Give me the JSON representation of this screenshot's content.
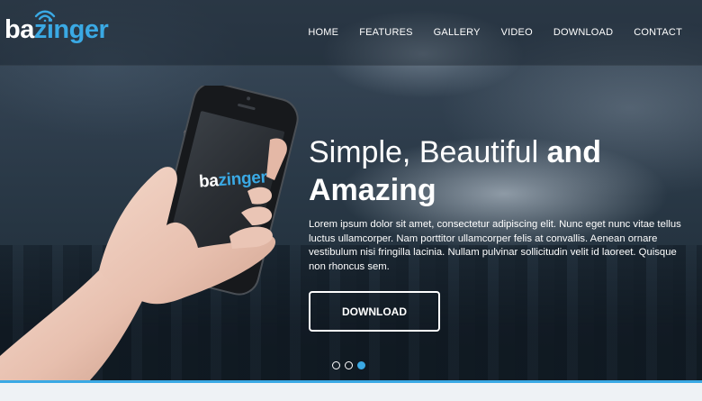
{
  "brand": {
    "prefix": "ba",
    "rest": "zinger",
    "accent": "#3aa9e4"
  },
  "nav": {
    "items": [
      "HOME",
      "FEATURES",
      "GALLERY",
      "VIDEO",
      "DOWNLOAD",
      "CONTACT"
    ]
  },
  "hero": {
    "headline_light": "Simple, Beautiful ",
    "headline_bold_1": "and",
    "headline_bold_2": "Amazing",
    "body": "Lorem ipsum dolor sit amet, consectetur adipiscing elit. Nunc eget nunc vitae tellus luctus ullamcorper. Nam porttitor ullamcorper felis at convallis. Aenean ornare vestibulum nisi fringilla lacinia. Nullam pulvinar sollicitudin velit id laoreet. Quisque non rhoncus sem.",
    "cta_label": "DOWNLOAD"
  },
  "phone_screen": {
    "prefix": "ba",
    "rest": "zinger"
  },
  "slider": {
    "count": 3,
    "active_index": 2
  },
  "icons": {
    "logo_signal": "wifi-signal-icon"
  }
}
